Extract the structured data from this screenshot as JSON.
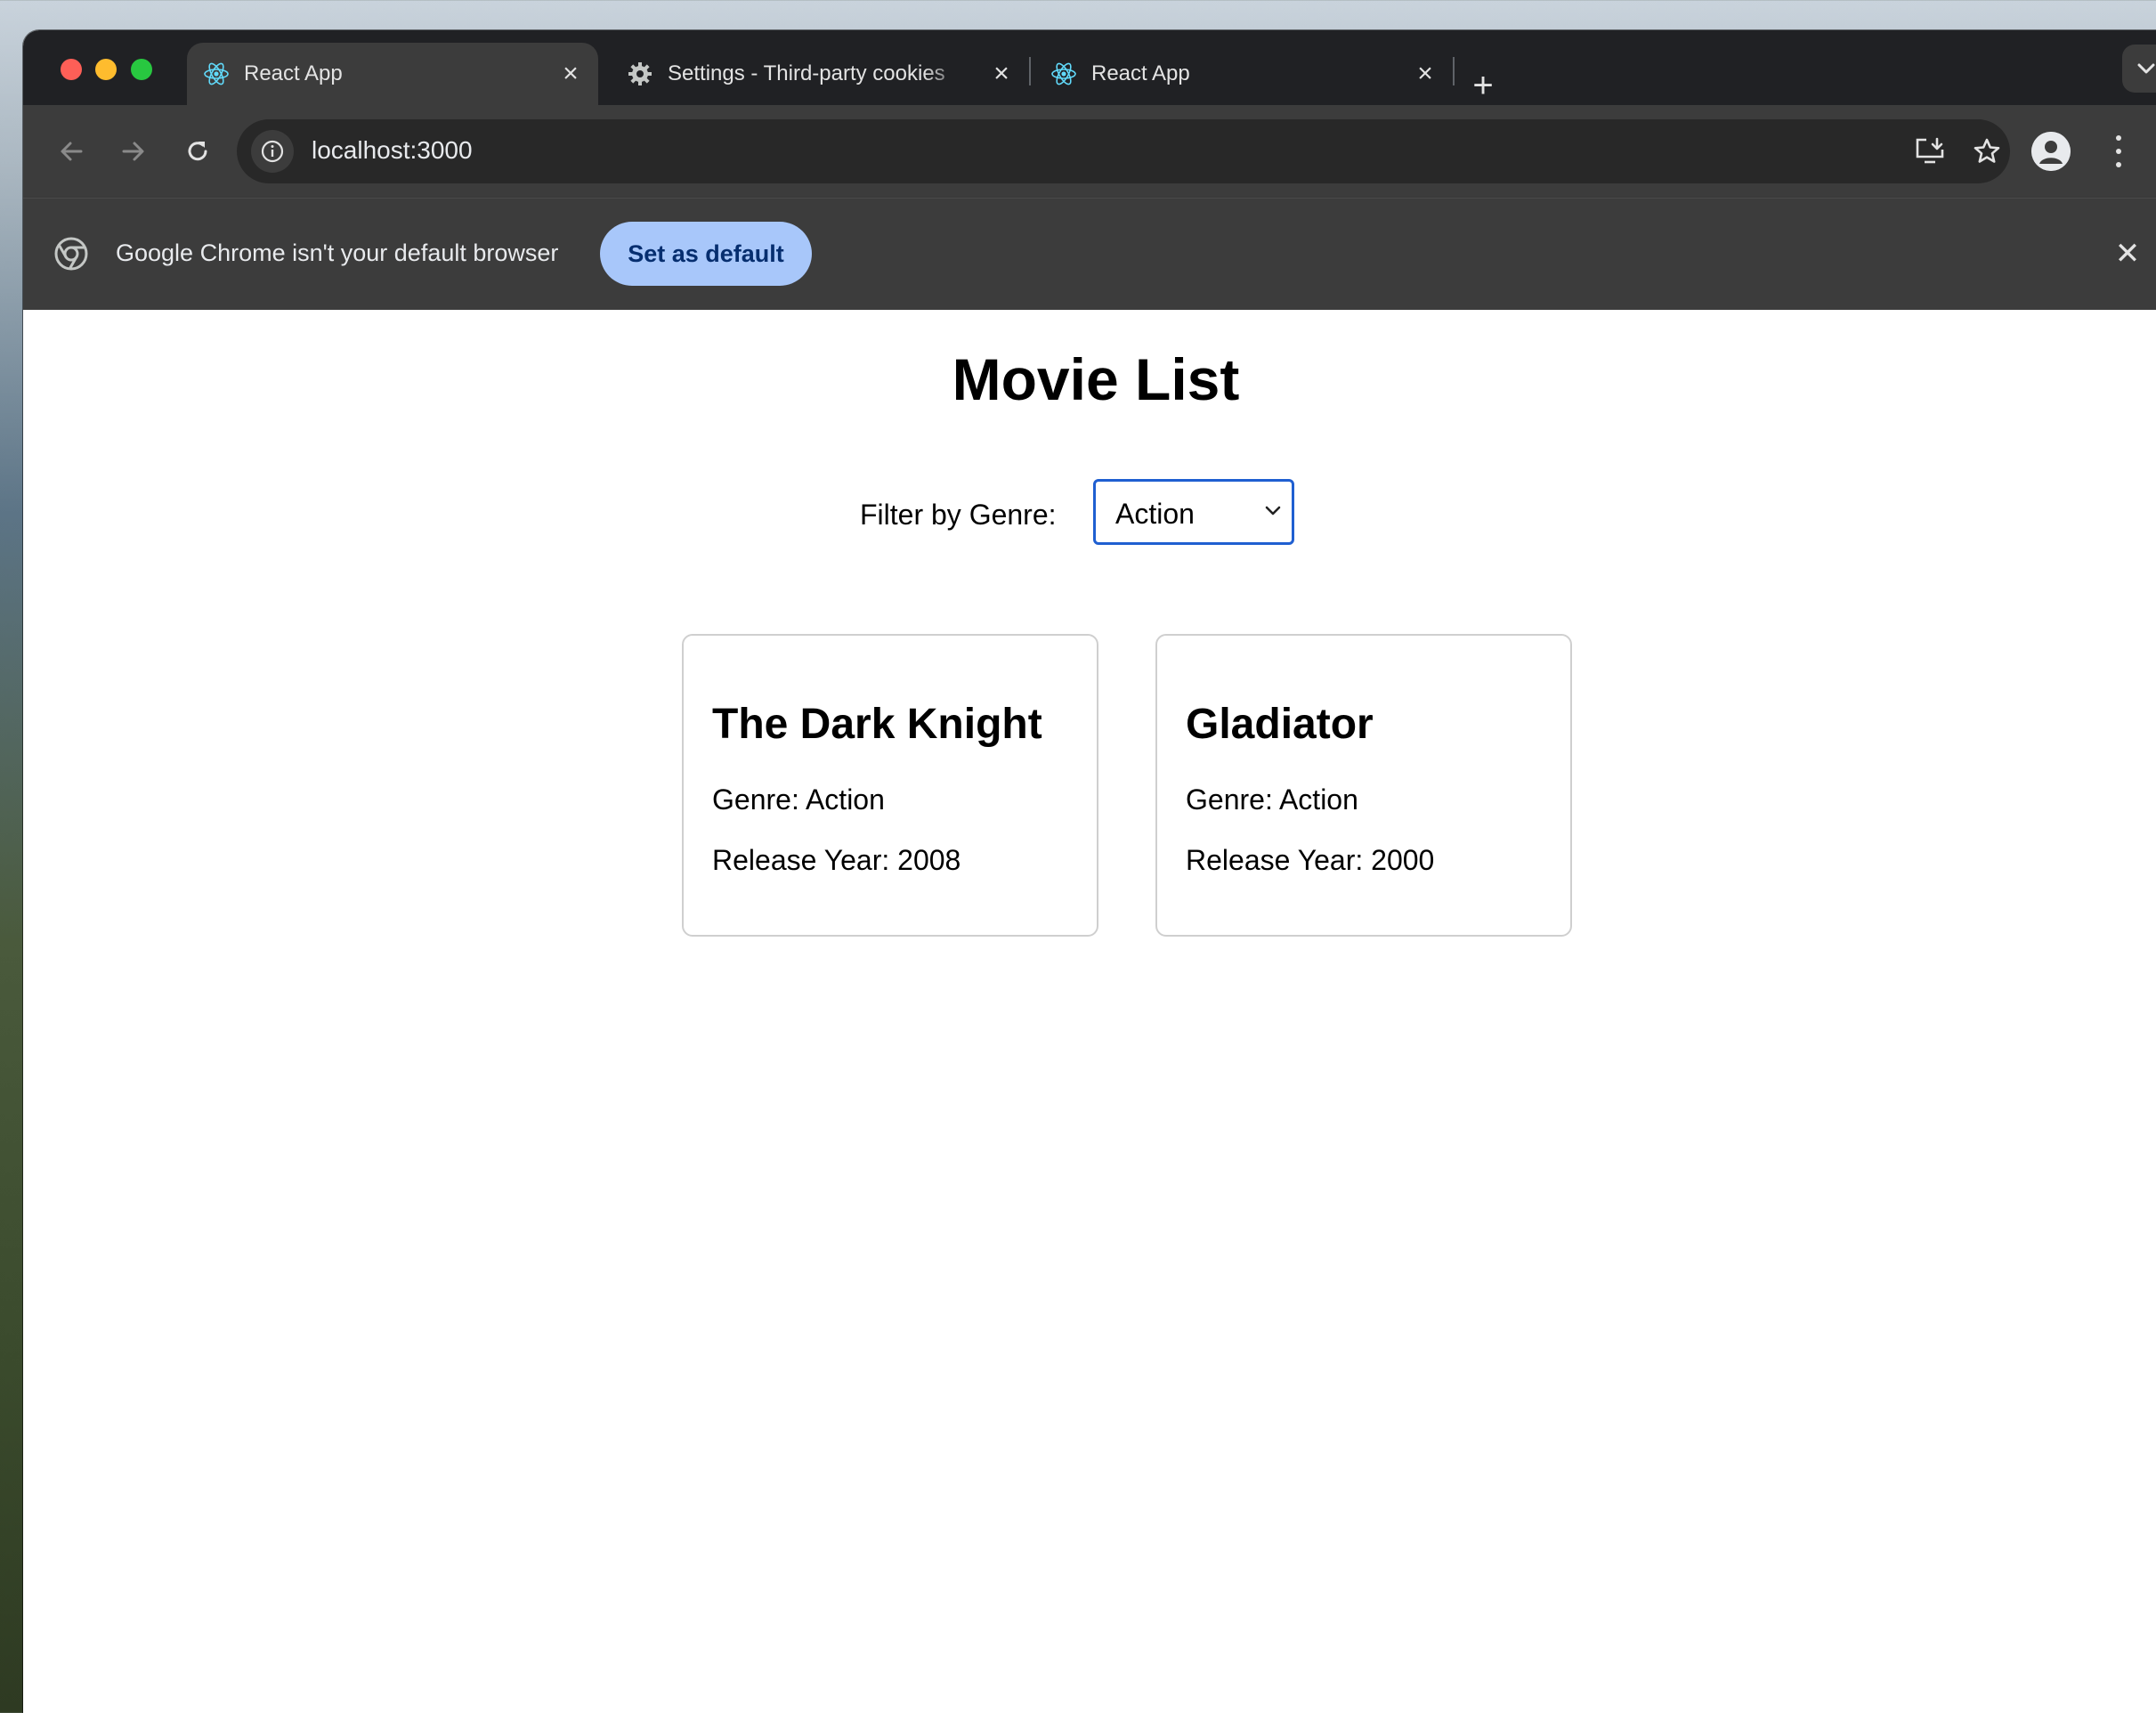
{
  "browser": {
    "tabs": [
      {
        "title": "React App",
        "favicon": "react-icon",
        "active": true
      },
      {
        "title": "Settings - Third-party cookies",
        "favicon": "gear-icon",
        "active": false
      },
      {
        "title": "React App",
        "favicon": "react-icon",
        "active": false
      }
    ],
    "url": "localhost:3000",
    "infobar": {
      "message": "Google Chrome isn't your default browser",
      "button_label": "Set as default"
    }
  },
  "app": {
    "title": "Movie List",
    "filter": {
      "label": "Filter by Genre:",
      "selected": "Action"
    },
    "movies": [
      {
        "title": "The Dark Knight",
        "genre": "Genre: Action",
        "year": "Release Year: 2008"
      },
      {
        "title": "Gladiator",
        "genre": "Genre: Action",
        "year": "Release Year: 2000"
      }
    ]
  },
  "colors": {
    "select_border": "#1f5fd1",
    "set_default_bg": "#a8c7fa",
    "tabstrip_bg": "#202124",
    "toolbar_bg": "#3c3c3c"
  }
}
